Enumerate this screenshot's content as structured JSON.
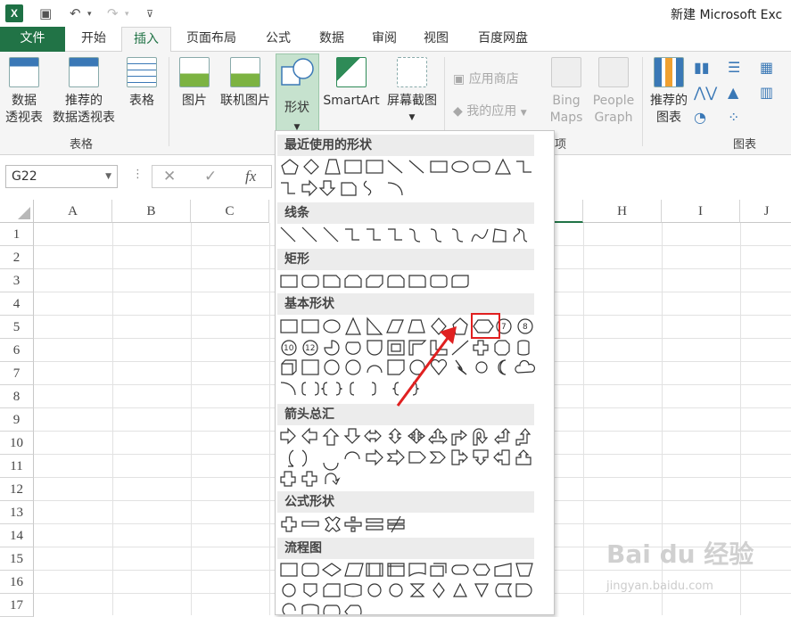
{
  "window": {
    "title": "新建 Microsoft Exc"
  },
  "quick_access": {
    "app_icon": "excel-logo-icon",
    "save_icon": "save-icon",
    "undo_icon": "undo-icon",
    "redo_icon": "redo-icon",
    "customize_icon": "customize-icon"
  },
  "ribbon_tabs": [
    {
      "label": "文件"
    },
    {
      "label": "开始"
    },
    {
      "label": "插入"
    },
    {
      "label": "页面布局"
    },
    {
      "label": "公式"
    },
    {
      "label": "数据"
    },
    {
      "label": "审阅"
    },
    {
      "label": "视图"
    },
    {
      "label": "百度网盘"
    }
  ],
  "ribbon": {
    "pivot": {
      "line1": "数据",
      "line2": "透视表"
    },
    "recommended_pivot": {
      "line1": "推荐的",
      "line2": "数据透视表"
    },
    "table": {
      "label": "表格"
    },
    "group_tables": "表格",
    "picture": {
      "label": "图片"
    },
    "online_picture": {
      "label": "联机图片"
    },
    "shapes": {
      "label": "形状"
    },
    "smartart": {
      "label": "SmartArt"
    },
    "screenshot": {
      "label": "屏幕截图"
    },
    "app_store": "应用商店",
    "my_apps": "我的应用",
    "bing_maps": {
      "line1": "Bing",
      "line2": "Maps"
    },
    "people_graph": {
      "line1": "People",
      "line2": "Graph"
    },
    "group_apps_tail": "项",
    "recommended_charts": {
      "line1": "推荐的",
      "line2": "图表"
    },
    "group_charts": "图表"
  },
  "formula_bar": {
    "name_box": "G22",
    "cancel": "✕",
    "enter": "✓",
    "fx": "fx"
  },
  "columns": [
    "A",
    "B",
    "C",
    "H",
    "I",
    "J"
  ],
  "rows": [
    "1",
    "2",
    "3",
    "4",
    "5",
    "6",
    "7",
    "8",
    "9",
    "10",
    "11",
    "12",
    "13",
    "14",
    "15",
    "16",
    "17"
  ],
  "gallery": {
    "categories": [
      {
        "label": "最近使用的形状"
      },
      {
        "label": "线条"
      },
      {
        "label": "矩形"
      },
      {
        "label": "基本形状"
      },
      {
        "label": "箭头总汇"
      },
      {
        "label": "公式形状"
      },
      {
        "label": "流程图"
      }
    ],
    "highlighted_shape": "hexagon",
    "badges": [
      "7",
      "8",
      "10",
      "12"
    ]
  },
  "colors": {
    "accent": "#217346",
    "highlight": "#e02020"
  },
  "watermark": {
    "main": "Bai du 经验",
    "sub": "jingyan.baidu.com"
  }
}
